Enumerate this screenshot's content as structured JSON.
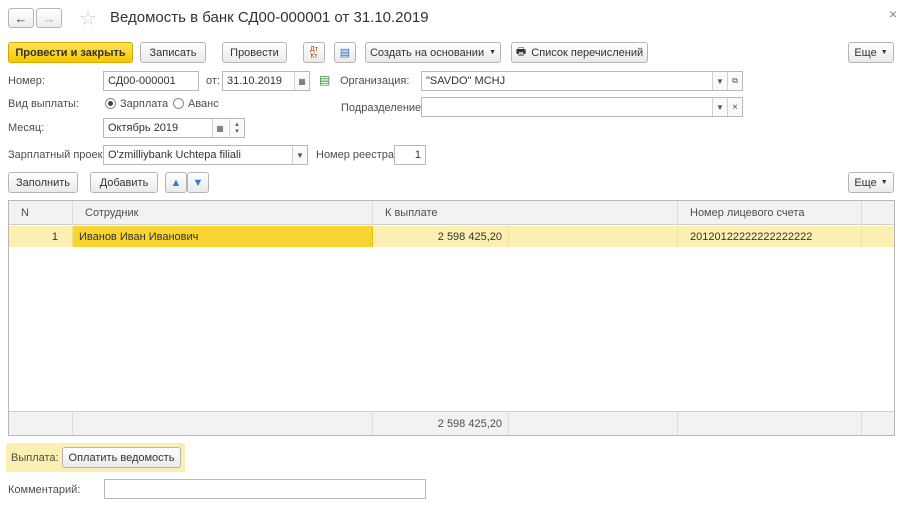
{
  "window": {
    "title": "Ведомость в банк СД00-000001 от 31.10.2019"
  },
  "toolbar": {
    "post_close": "Провести и закрыть",
    "save": "Записать",
    "post": "Провести",
    "create_based": "Создать на основании",
    "transfer_list": "Список перечислений",
    "more": "Еще"
  },
  "form": {
    "number_label": "Номер:",
    "number_value": "СД00-000001",
    "from_label": "от:",
    "date_value": "31.10.2019",
    "org_label": "Организация:",
    "org_value": "\"SAVDO\" MCHJ",
    "payment_type_label": "Вид выплаты:",
    "salary_option": "Зарплата",
    "advance_option": "Аванс",
    "division_label": "Подразделение:",
    "division_value": "",
    "month_label": "Месяц:",
    "month_value": "Октябрь 2019",
    "salary_project_label": "Зарплатный проект:",
    "salary_project_value": "O'zmilliybank Uchtepa filiali",
    "registry_label": "Номер реестра:",
    "registry_value": "1"
  },
  "table_toolbar": {
    "fill": "Заполнить",
    "add": "Добавить",
    "more": "Еще"
  },
  "table": {
    "columns": [
      "N",
      "Сотрудник",
      "К выплате",
      "Номер лицевого счета"
    ],
    "rows": [
      {
        "n": "1",
        "employee": "Иванов Иван Иванович",
        "amount": "2 598 425,20",
        "account": "20120122222222222222"
      }
    ],
    "total_amount": "2 598 425,20"
  },
  "payment": {
    "label": "Выплата:",
    "pay_button": "Оплатить ведомость"
  },
  "comment": {
    "label": "Комментарий:",
    "value": ""
  }
}
